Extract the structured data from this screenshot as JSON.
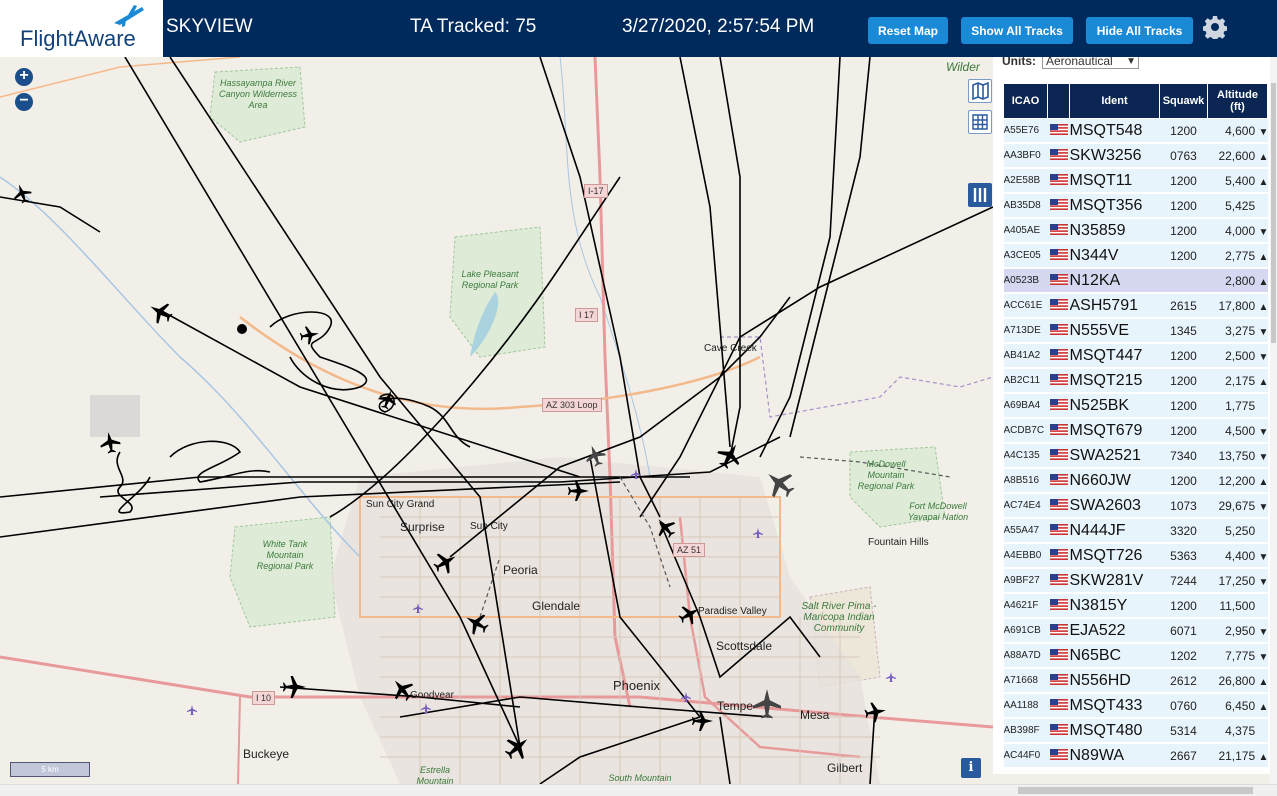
{
  "header": {
    "logo_text": "FlightAware",
    "app_name": "SKYVIEW",
    "tracked_label": "TA Tracked: 75",
    "datetime": "3/27/2020, 2:57:54 PM",
    "buttons": {
      "reset": "Reset Map",
      "show_all": "Show All Tracks",
      "hide_all": "Hide All Tracks"
    }
  },
  "panel": {
    "units_label": "Units:",
    "units_value": "Aeronautical",
    "columns": [
      "ICAO",
      "Ident",
      "Squawk",
      "Altitude (ft)"
    ],
    "rows": [
      {
        "icao": "A55E76",
        "ident": "MSQT548",
        "squawk": "1200",
        "alt": "4,600",
        "trend": "▼"
      },
      {
        "icao": "AA3BF0",
        "ident": "SKW3256",
        "squawk": "0763",
        "alt": "22,600",
        "trend": "▲"
      },
      {
        "icao": "A2E58B",
        "ident": "MSQT11",
        "squawk": "1200",
        "alt": "5,400",
        "trend": "▲"
      },
      {
        "icao": "AB35D8",
        "ident": "MSQT356",
        "squawk": "1200",
        "alt": "5,425",
        "trend": ""
      },
      {
        "icao": "A405AE",
        "ident": "N35859",
        "squawk": "1200",
        "alt": "4,000",
        "trend": "▼"
      },
      {
        "icao": "A3CE05",
        "ident": "N344V",
        "squawk": "1200",
        "alt": "2,775",
        "trend": "▲"
      },
      {
        "icao": "A0523B",
        "ident": "N12KA",
        "squawk": "",
        "alt": "2,800",
        "trend": "▲",
        "selected": true
      },
      {
        "icao": "ACC61E",
        "ident": "ASH5791",
        "squawk": "2615",
        "alt": "17,800",
        "trend": "▲"
      },
      {
        "icao": "A713DE",
        "ident": "N555VE",
        "squawk": "1345",
        "alt": "3,275",
        "trend": "▼"
      },
      {
        "icao": "AB41A2",
        "ident": "MSQT447",
        "squawk": "1200",
        "alt": "2,500",
        "trend": "▼"
      },
      {
        "icao": "AB2C11",
        "ident": "MSQT215",
        "squawk": "1200",
        "alt": "2,175",
        "trend": "▲"
      },
      {
        "icao": "A69BA4",
        "ident": "N525BK",
        "squawk": "1200",
        "alt": "1,775",
        "trend": ""
      },
      {
        "icao": "ACDB7C",
        "ident": "MSQT679",
        "squawk": "1200",
        "alt": "4,500",
        "trend": "▼"
      },
      {
        "icao": "A4C135",
        "ident": "SWA2521",
        "squawk": "7340",
        "alt": "13,750",
        "trend": "▼"
      },
      {
        "icao": "A8B516",
        "ident": "N660JW",
        "squawk": "1200",
        "alt": "12,200",
        "trend": "▲"
      },
      {
        "icao": "AC74E4",
        "ident": "SWA2603",
        "squawk": "1073",
        "alt": "29,675",
        "trend": "▼"
      },
      {
        "icao": "A55A47",
        "ident": "N444JF",
        "squawk": "3320",
        "alt": "5,250",
        "trend": ""
      },
      {
        "icao": "A4EBB0",
        "ident": "MSQT726",
        "squawk": "5363",
        "alt": "4,400",
        "trend": "▼"
      },
      {
        "icao": "A9BF27",
        "ident": "SKW281V",
        "squawk": "7244",
        "alt": "17,250",
        "trend": "▼"
      },
      {
        "icao": "A4621F",
        "ident": "N3815Y",
        "squawk": "1200",
        "alt": "11,500",
        "trend": ""
      },
      {
        "icao": "A691CB",
        "ident": "EJA522",
        "squawk": "6071",
        "alt": "2,950",
        "trend": "▼"
      },
      {
        "icao": "A88A7D",
        "ident": "N65BC",
        "squawk": "1202",
        "alt": "7,775",
        "trend": "▼"
      },
      {
        "icao": "A71668",
        "ident": "N556HD",
        "squawk": "2612",
        "alt": "26,800",
        "trend": "▲"
      },
      {
        "icao": "AA1188",
        "ident": "MSQT433",
        "squawk": "0760",
        "alt": "6,450",
        "trend": "▲"
      },
      {
        "icao": "AB398F",
        "ident": "MSQT480",
        "squawk": "5314",
        "alt": "4,375",
        "trend": ""
      },
      {
        "icao": "AC44F0",
        "ident": "N89WA",
        "squawk": "2667",
        "alt": "21,175",
        "trend": "▲"
      }
    ]
  },
  "map": {
    "cities": [
      "Surprise",
      "Sun City",
      "Sun City Grand",
      "Peoria",
      "Glendale",
      "Phoenix",
      "Scottsdale",
      "Tempe",
      "Mesa",
      "Gilbert",
      "Buckeye",
      "Goodyear",
      "Cave Creek",
      "Fountain Hills",
      "Paradise Valley"
    ],
    "parks": {
      "hassayampa": "Hassayampa River Canyon Wilderness Area",
      "lake_pleasant": "Lake Pleasant Regional Park",
      "white_tank": "White Tank Mountain Regional Park",
      "mcdowell": "McDowell Mountain Regional Park",
      "fort_mcdowell": "Fort McDowell Yavapai Nation",
      "salt_river": "Salt River Pima - Maricopa Indian Community",
      "estrella": "Estrella Mountain",
      "south_mountain": "South Mountain",
      "wilder": "Wilder"
    },
    "roads": {
      "i17a": "I-17",
      "i17b": "I 17",
      "az303": "AZ 303 Loop",
      "az51": "AZ 51",
      "i10": "I 10"
    },
    "scale": "5 km",
    "info": "i"
  },
  "colors": {
    "header_bg": "#002a5c",
    "button_bg": "#1a8ad6",
    "table_header": "#0b2653",
    "row_bg": "#e8f4fb",
    "row_selected": "#d5d8f0"
  }
}
